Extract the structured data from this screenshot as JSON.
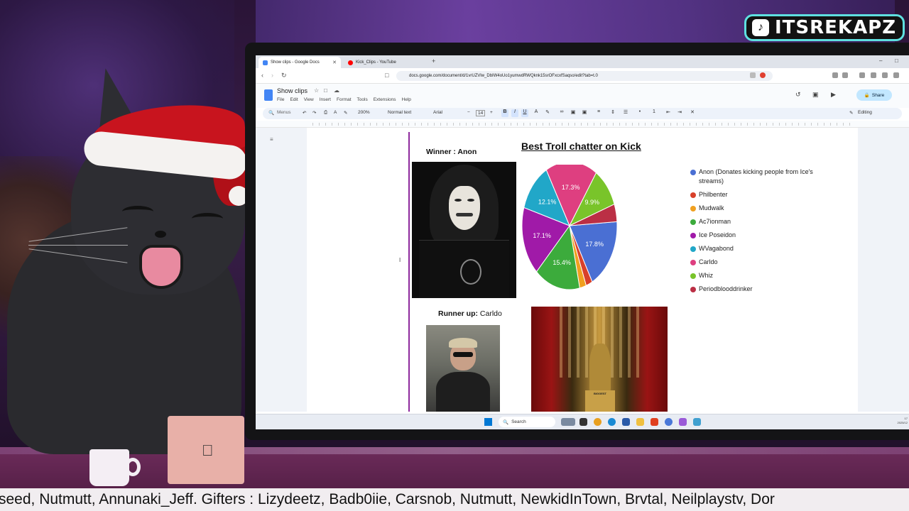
{
  "overlay": {
    "channel_badge": "ITSREKAPZ",
    "badge_icon": "tiktok-icon",
    "ticker": "seed, Nutmutt, Annunaki_Jeff. Gifters : Lizydeetz, Badb0iie, Carsnob, Nutmutt, NewkidInTown, Brvtal, Neilplaystv, Dor"
  },
  "browser": {
    "tabs": [
      {
        "label": "Show clips - Google Docs",
        "icon": "google-docs-icon",
        "color": "#4285f4",
        "active": true
      },
      {
        "label": "Kick_Clips - YouTube",
        "icon": "youtube-icon",
        "color": "#ff0000",
        "active": false
      }
    ],
    "url": "docs.google.com/document/d/1vrUZVlw_DbIW4oUo1yumwdRWQknk15srOFxcxfSaqso/edit?tab=t.0"
  },
  "docs": {
    "title": "Show clips",
    "menu": [
      "File",
      "Edit",
      "View",
      "Insert",
      "Format",
      "Tools",
      "Extensions",
      "Help"
    ],
    "share_label": "Share",
    "toolbar": {
      "search": "Menus",
      "zoom": "200%",
      "style": "Normal text",
      "font": "Arial",
      "font_size": "14",
      "mode": "Editing"
    }
  },
  "content": {
    "winner_label": "Winner : Anon",
    "chart_title": "Best Troll chatter on Kick",
    "runner_label": "Runner up:",
    "runner_name": "Carldo",
    "plinth_text": "BIGGEST"
  },
  "chart_data": {
    "type": "pie",
    "title": "",
    "legend_position": "right",
    "slices": [
      {
        "name": "Anon (Donates kicking people from Ice's streams)",
        "value": 17.8,
        "color": "#4a6fd3",
        "label": "17.8%"
      },
      {
        "name": "Philbenter",
        "value": 2.2,
        "color": "#d8402a",
        "label": ""
      },
      {
        "name": "Mudwalk",
        "value": 2.2,
        "color": "#f0a020",
        "label": ""
      },
      {
        "name": "Ac7ionman",
        "value": 15.4,
        "color": "#3cab3c",
        "label": "15.4%"
      },
      {
        "name": "Ice Poseidon",
        "value": 17.1,
        "color": "#a01aa8",
        "label": "17.1%"
      },
      {
        "name": "WVagabond",
        "value": 12.1,
        "color": "#21a7c8",
        "label": "12.1%"
      },
      {
        "name": "Carldo",
        "value": 17.3,
        "color": "#de3f80",
        "label": "17.3%"
      },
      {
        "name": "Whiz",
        "value": 9.9,
        "color": "#79c42a",
        "label": "9.9%"
      },
      {
        "name": "Periodblooddrinker",
        "value": 4.4,
        "color": "#bb2f45",
        "label": ""
      }
    ]
  },
  "taskbar": {
    "search_label": "Search",
    "clock_time": "17",
    "clock_date": "2025/12"
  }
}
